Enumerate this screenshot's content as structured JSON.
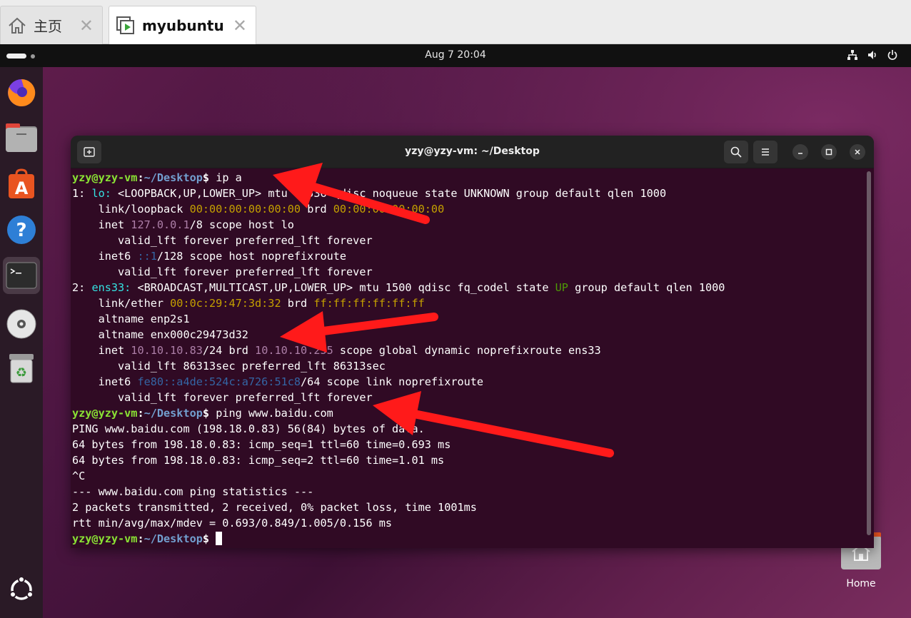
{
  "tabs": [
    {
      "label": "主页",
      "icon": "home-icon"
    },
    {
      "label": "myubuntu",
      "icon": "vm-icon"
    }
  ],
  "topbar": {
    "clock": "Aug 7  20:04",
    "tray_icons": [
      "network-icon",
      "volume-icon",
      "power-icon"
    ]
  },
  "dock": {
    "items": [
      "firefox-icon",
      "files-icon",
      "app-center-icon",
      "help-icon",
      "terminal-icon",
      "disc-icon",
      "trash-icon"
    ],
    "bottom": "show-apps-icon"
  },
  "desktop": {
    "home_label": "Home"
  },
  "terminal": {
    "title": "yzy@yzy-vm: ~/Desktop",
    "prompt_user": "yzy@yzy-vm",
    "prompt_colon": ":",
    "prompt_path": "~/Desktop",
    "prompt_dollar": "$",
    "lines": [
      {
        "k": "cmd",
        "text": " ip a"
      },
      {
        "k": "if",
        "num": "1: ",
        "name": "lo:",
        "rest": " <LOOPBACK,UP,LOWER_UP> mtu 65536 qdisc noqueue state UNKNOWN group default qlen 1000"
      },
      {
        "k": "mac",
        "pre": "    link/loopback ",
        "mac": "00:00:00:00:00:00",
        "mid": " brd ",
        "brd": "00:00:00:00:00:00",
        "post": ""
      },
      {
        "k": "ip4",
        "pre": "    inet ",
        "ip": "127.0.0.1",
        "post": "/8 scope host lo"
      },
      {
        "k": "plain",
        "text": "       valid_lft forever preferred_lft forever"
      },
      {
        "k": "ip6",
        "pre": "    inet6 ",
        "ip": "::1",
        "post": "/128 scope host noprefixroute"
      },
      {
        "k": "plain",
        "text": "       valid_lft forever preferred_lft forever"
      },
      {
        "k": "if2",
        "num": "2: ",
        "name": "ens33:",
        "rest": " <BROADCAST,MULTICAST,UP,LOWER_UP> mtu 1500 qdisc fq_codel state ",
        "state": "UP",
        "tail": " group default qlen 1000"
      },
      {
        "k": "mac",
        "pre": "    link/ether ",
        "mac": "00:0c:29:47:3d:32",
        "mid": " brd ",
        "brd": "ff:ff:ff:ff:ff:ff",
        "post": ""
      },
      {
        "k": "plain",
        "text": "    altname enp2s1"
      },
      {
        "k": "plain",
        "text": "    altname enx000c29473d32"
      },
      {
        "k": "ip4b",
        "pre": "    inet ",
        "ip": "10.10.10.83",
        "mid": "/24 brd ",
        "brd": "10.10.10.255",
        "post": " scope global dynamic noprefixroute ens33"
      },
      {
        "k": "plain",
        "text": "       valid_lft 86313sec preferred_lft 86313sec"
      },
      {
        "k": "ip6",
        "pre": "    inet6 ",
        "ip": "fe80::a4de:524c:a726:51c8",
        "post": "/64 scope link noprefixroute"
      },
      {
        "k": "plain",
        "text": "       valid_lft forever preferred_lft forever"
      },
      {
        "k": "cmd",
        "text": " ping www.baidu.com"
      },
      {
        "k": "plain",
        "text": "PING www.baidu.com (198.18.0.83) 56(84) bytes of data."
      },
      {
        "k": "plain",
        "text": "64 bytes from 198.18.0.83: icmp_seq=1 ttl=60 time=0.693 ms"
      },
      {
        "k": "plain",
        "text": "64 bytes from 198.18.0.83: icmp_seq=2 ttl=60 time=1.01 ms"
      },
      {
        "k": "plain",
        "text": "^C"
      },
      {
        "k": "plain",
        "text": "--- www.baidu.com ping statistics ---"
      },
      {
        "k": "plain",
        "text": "2 packets transmitted, 2 received, 0% packet loss, time 1001ms"
      },
      {
        "k": "plain",
        "text": "rtt min/avg/max/mdev = 0.693/0.849/1.005/0.156 ms"
      },
      {
        "k": "cursor",
        "text": " "
      }
    ]
  },
  "colors": {
    "terminal_bg": "#300a24",
    "prompt_user": "#8ae234",
    "prompt_path": "#729fcf",
    "annotation_arrow": "#ff1a1a"
  }
}
